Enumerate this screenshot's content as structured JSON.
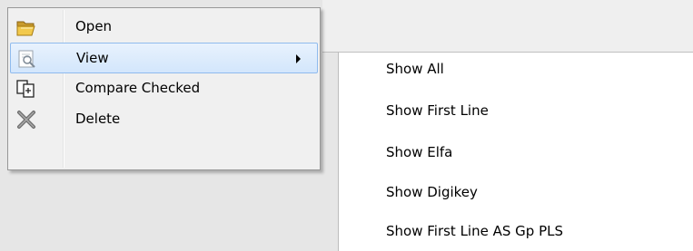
{
  "context_menu": {
    "items": [
      {
        "label": "Open",
        "icon": "open-folder-icon"
      },
      {
        "label": "View",
        "icon": "view-icon",
        "highlighted": true,
        "has_submenu": true
      },
      {
        "label": "Compare Checked",
        "icon": "compare-icon"
      },
      {
        "label": "Delete",
        "icon": "delete-x-icon"
      }
    ]
  },
  "submenu": {
    "items": [
      {
        "label": "Show All"
      },
      {
        "label": "Show First Line"
      },
      {
        "label": "Show Elfa"
      },
      {
        "label": "Show Digikey"
      },
      {
        "label": "Show First Line AS Gp PLS"
      }
    ]
  },
  "colors": {
    "highlight_border": "#8fbbee",
    "menu_background": "#f0f0f0"
  }
}
